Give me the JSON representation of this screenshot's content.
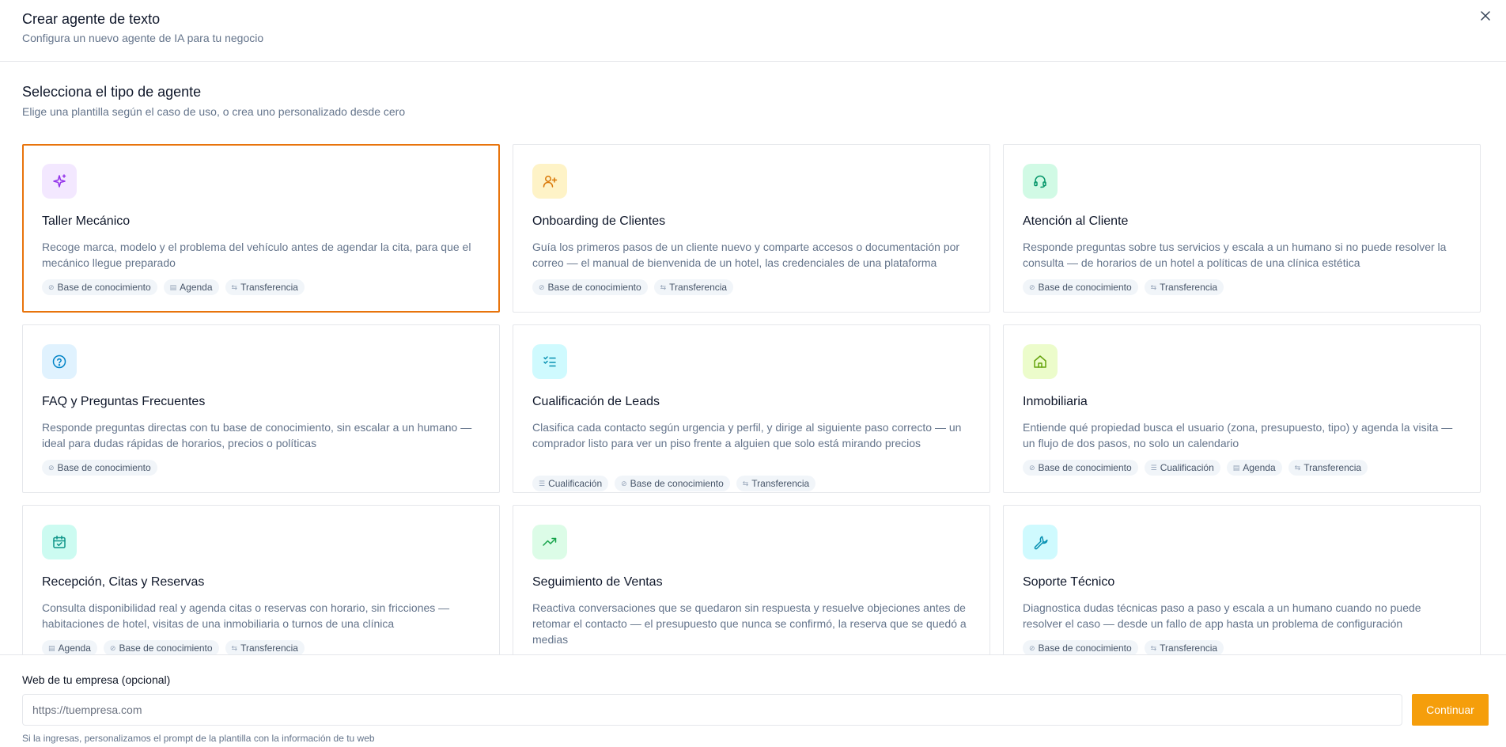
{
  "header": {
    "title": "Crear agente de texto",
    "subtitle": "Configura un nuevo agente de IA para tu negocio"
  },
  "section": {
    "title": "Selecciona el tipo de agente",
    "subtitle": "Elige una plantilla según el caso de uso, o crea uno personalizado desde cero"
  },
  "accent_color": "#e8740c",
  "button_color": "#f59e0b",
  "cards": [
    {
      "icon": "sparkles-icon",
      "icon_bg": "#f3e8ff",
      "icon_color": "#9333ea",
      "title": "Taller Mecánico",
      "description": "Recoge marca, modelo y el problema del vehículo antes de agendar la cita, para que el mecánico llegue preparado",
      "tags": [
        "Base de conocimiento",
        "Agenda",
        "Transferencia"
      ],
      "selected": true
    },
    {
      "icon": "user-plus-icon",
      "icon_bg": "#fef3c7",
      "icon_color": "#d97706",
      "title": "Onboarding de Clientes",
      "description": "Guía los primeros pasos de un cliente nuevo y comparte accesos o documentación por correo — el manual de bienvenida de un hotel, las credenciales de una plataforma",
      "tags": [
        "Base de conocimiento",
        "Transferencia"
      ],
      "selected": false
    },
    {
      "icon": "headset-icon",
      "icon_bg": "#d1fae5",
      "icon_color": "#059669",
      "title": "Atención al Cliente",
      "description": "Responde preguntas sobre tus servicios y escala a un humano si no puede resolver la consulta — de horarios de un hotel a políticas de una clínica estética",
      "tags": [
        "Base de conocimiento",
        "Transferencia"
      ],
      "selected": false
    },
    {
      "icon": "question-circle-icon",
      "icon_bg": "#e0f2fe",
      "icon_color": "#0284c7",
      "title": "FAQ y Preguntas Frecuentes",
      "description": "Responde preguntas directas con tu base de conocimiento, sin escalar a un humano — ideal para dudas rápidas de horarios, precios o políticas",
      "tags": [
        "Base de conocimiento"
      ],
      "selected": false
    },
    {
      "icon": "list-checks-icon",
      "icon_bg": "#cffafe",
      "icon_color": "#0891b2",
      "title": "Cualificación de Leads",
      "description": "Clasifica cada contacto según urgencia y perfil, y dirige al siguiente paso correcto — un comprador listo para ver un piso frente a alguien que solo está mirando precios",
      "tags": [
        "Cualificación",
        "Base de conocimiento",
        "Transferencia"
      ],
      "selected": false
    },
    {
      "icon": "home-icon",
      "icon_bg": "#ecfccb",
      "icon_color": "#65a30d",
      "title": "Inmobiliaria",
      "description": "Entiende qué propiedad busca el usuario (zona, presupuesto, tipo) y agenda la visita — un flujo de dos pasos, no solo un calendario",
      "tags": [
        "Base de conocimiento",
        "Cualificación",
        "Agenda",
        "Transferencia"
      ],
      "selected": false
    },
    {
      "icon": "calendar-check-icon",
      "icon_bg": "#ccfbf1",
      "icon_color": "#0d9488",
      "title": "Recepción, Citas y Reservas",
      "description": "Consulta disponibilidad real y agenda citas o reservas con horario, sin fricciones — habitaciones de hotel, visitas de una inmobiliaria o turnos de una clínica",
      "tags": [
        "Agenda",
        "Base de conocimiento",
        "Transferencia"
      ],
      "selected": false
    },
    {
      "icon": "trending-up-icon",
      "icon_bg": "#dcfce7",
      "icon_color": "#16a34a",
      "title": "Seguimiento de Ventas",
      "description": "Reactiva conversaciones que se quedaron sin respuesta y resuelve objeciones antes de retomar el contacto — el presupuesto que nunca se confirmó, la reserva que se quedó a medias",
      "tags": [],
      "selected": false
    },
    {
      "icon": "wrench-icon",
      "icon_bg": "#cffafe",
      "icon_color": "#0891b2",
      "title": "Soporte Técnico",
      "description": "Diagnostica dudas técnicas paso a paso y escala a un humano cuando no puede resolver el caso — desde un fallo de app hasta un problema de configuración",
      "tags": [
        "Base de conocimiento",
        "Transferencia"
      ],
      "selected": false
    }
  ],
  "tag_icons": {
    "Base de conocimiento": "database-icon",
    "Agenda": "calendar-icon",
    "Transferencia": "transfer-icon",
    "Cualificación": "filter-icon"
  },
  "footer": {
    "label": "Web de tu empresa (opcional)",
    "url_placeholder": "https://tuempresa.com",
    "url_value": "",
    "continue_label": "Continuar",
    "hint": "Si la ingresas, personalizamos el prompt de la plantilla con la información de tu web"
  }
}
